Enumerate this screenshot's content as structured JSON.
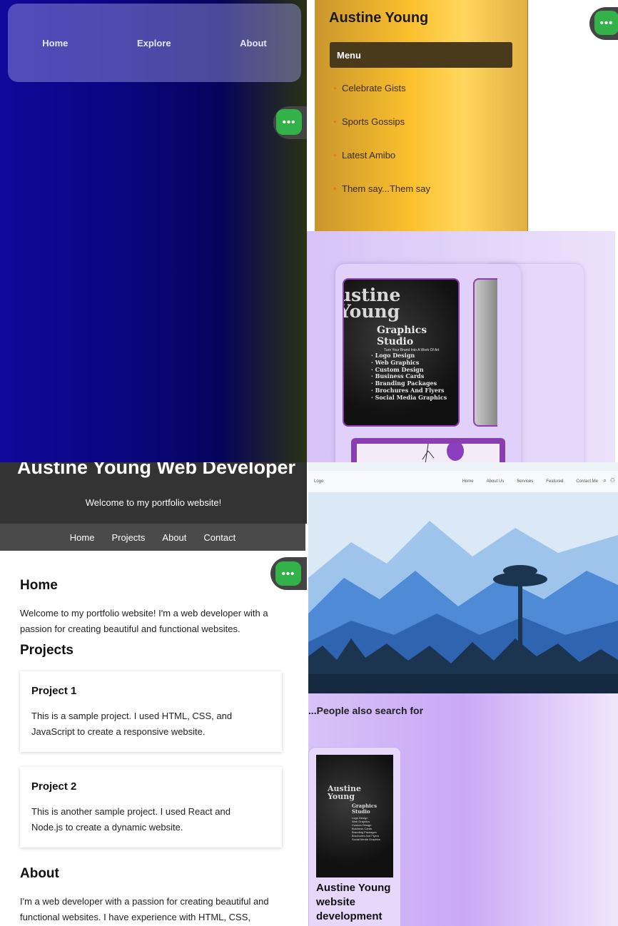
{
  "panel1": {
    "nav": [
      "Home",
      "Explore",
      "About"
    ],
    "fab_label": "•••"
  },
  "panel2": {
    "title": "Austine Young",
    "menu_label": "Menu",
    "items": [
      "Celebrate Gists",
      "Sports Gossips",
      "Latest Amibo",
      "Them say...Them say"
    ],
    "fab_label": "•••"
  },
  "panel3": {
    "poster_big": "ustine\nYoung",
    "poster_studio": "Graphics\nStudio",
    "poster_tag": "Turn Your Brand Into A Work Of Art",
    "poster_services": [
      "· Logo Design",
      "· Web Graphics",
      "· Custom Design",
      "· Business  Cards",
      "· Branding Packages",
      "· Brochures And Flyers",
      "· Social Media Graphics"
    ]
  },
  "panel4": {
    "hero_title": "Austine Young Web Developer",
    "hero_sub": "Welcome to my portfolio website!",
    "nav": [
      "Home",
      "Projects",
      "About",
      "Contact"
    ],
    "fab_label": "•••",
    "home_heading": "Home",
    "home_text": "Welcome to my portfolio website! I'm a web developer with a passion for creating beautiful and functional websites.",
    "projects_heading": "Projects",
    "projects": [
      {
        "title": "Project 1",
        "desc": "This is a sample project. I used HTML, CSS, and JavaScript to create a responsive website."
      },
      {
        "title": "Project 2",
        "desc": "This is another sample project. I used React and Node.js to create a dynamic website."
      }
    ],
    "about_heading": "About",
    "about_text": "I'm a web developer with a passion for creating beautiful and functional websites. I have experience with HTML, CSS,"
  },
  "panel5": {
    "logo": "Logo",
    "nav": [
      "Home",
      "About Us",
      "Services",
      "Featured",
      "Contact Me"
    ],
    "colors": {
      "sky": "#dbe9f7",
      "mountain_far": "#9ec4ec",
      "mountain_mid": "#4f8ad6",
      "mountain_near": "#2f64b0",
      "forest": "#1b3550"
    }
  },
  "panel6": {
    "heading": "...People also search for",
    "card_title": "Austine Young website development",
    "thumb_big": "Austine\nYoung",
    "thumb_studio": "Graphics\nStudio",
    "thumb_services": [
      "Logo Design",
      "Web Graphics",
      "Custom Design",
      "Business Cards",
      "Branding Packages",
      "Brochures And Flyers",
      "Social Media Graphics"
    ]
  },
  "colors": {
    "fab": "#34b24a",
    "gold": "#fbc02d",
    "lavender": "#d7c3f7",
    "hero_bg": "#333333"
  }
}
